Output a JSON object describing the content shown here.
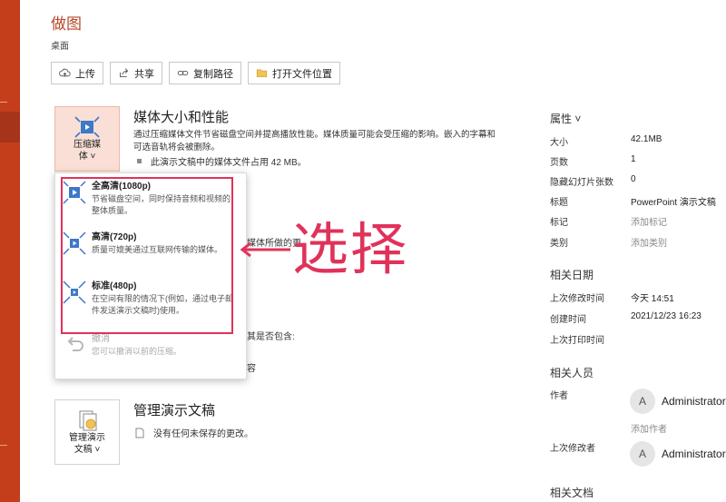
{
  "app": {
    "title": "做图",
    "location": "桌面"
  },
  "toolbar": {
    "upload": "上传",
    "share": "共享",
    "copy_path": "复制路径",
    "open_location": "打开文件位置"
  },
  "media_section": {
    "tile_label_1": "压缩媒",
    "tile_label_2": "体 ˅",
    "title": "媒体大小和性能",
    "description": "通过压缩媒体文件节省磁盘空间并提高播放性能。媒体质量可能会受压缩的影响。嵌入的字幕和可选音轨将会被删除。",
    "bullet": "此演示文稿中的媒体文件占用 42 MB。"
  },
  "compress_menu": {
    "items": [
      {
        "name": "全高清(1080p)",
        "desc": "节省磁盘空间，同时保持音频和视频的整体质量。"
      },
      {
        "name": "高清(720p)",
        "desc": "质量可媲美通过互联网传输的媒体。"
      },
      {
        "name": "标准(480p)",
        "desc": "在空间有限的情况下(例如，通过电子邮件发送演示文稿时)使用。"
      },
      {
        "name": "撤消",
        "desc": "您可以撤消以前的压缩。"
      }
    ]
  },
  "hidden_text": {
    "line1": "媒体所做的更",
    "line2": "其是否包含:",
    "line3": "容"
  },
  "manage_section": {
    "tile_label_1": "管理演示",
    "tile_label_2": "文稿 ˅",
    "title": "管理演示文稿",
    "status": "没有任何未保存的更改。"
  },
  "annotation": {
    "text": "选择"
  },
  "properties": {
    "header": "属性 ˅",
    "rows": [
      {
        "key": "大小",
        "value": "42.1MB"
      },
      {
        "key": "页数",
        "value": "1"
      },
      {
        "key": "隐藏幻灯片张数",
        "value": "0"
      },
      {
        "key": "标题",
        "value": "PowerPoint 演示文稿"
      },
      {
        "key": "标记",
        "value": "添加标记"
      },
      {
        "key": "类别",
        "value": "添加类别"
      }
    ],
    "dates_header": "相关日期",
    "dates": [
      {
        "key": "上次修改时间",
        "value": "今天 14:51"
      },
      {
        "key": "创建时间",
        "value": "2021/12/23 16:23"
      },
      {
        "key": "上次打印时间",
        "value": ""
      }
    ],
    "people_header": "相关人员",
    "author_label": "作者",
    "author_initial": "A",
    "author_name": "Administrator",
    "add_author": "添加作者",
    "last_modified_by_label": "上次修改者",
    "modifier_initial": "A",
    "modifier_name": "Administrator",
    "docs_header": "相关文档"
  },
  "colors": {
    "brand": "#c43e1c",
    "annotation": "#e0325a"
  }
}
